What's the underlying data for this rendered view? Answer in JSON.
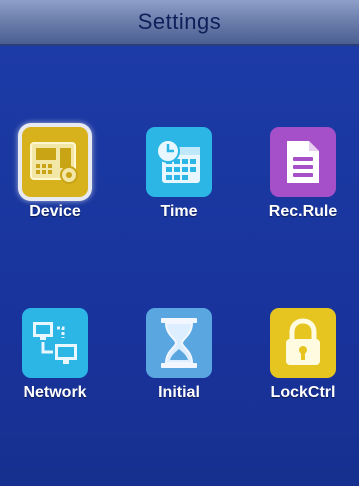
{
  "header": {
    "title": "Settings"
  },
  "colors": {
    "background": "#1a37a0",
    "title_bar": "#6d80ad",
    "device_tile": "#d7b21d",
    "time_tile": "#2bb6e6",
    "rec_rule_tile": "#a54fc9",
    "network_tile": "#2bb6e6",
    "initial_tile": "#5aa6e0",
    "lockctrl_tile": "#e6c520"
  },
  "menu": {
    "items": [
      {
        "label": "Device",
        "icon": "device-icon",
        "selected": true
      },
      {
        "label": "Time",
        "icon": "calendar-clock-icon",
        "selected": false
      },
      {
        "label": "Rec.Rule",
        "icon": "document-icon",
        "selected": false
      },
      {
        "label": "Network",
        "icon": "network-icon",
        "selected": false
      },
      {
        "label": "Initial",
        "icon": "hourglass-icon",
        "selected": false
      },
      {
        "label": "LockCtrl",
        "icon": "lock-icon",
        "selected": false
      }
    ]
  }
}
